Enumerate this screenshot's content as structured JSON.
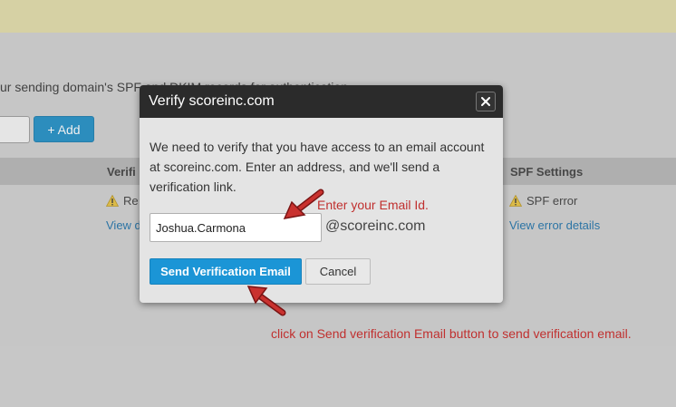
{
  "background": {
    "description": "ur sending domain's SPF and DKIM records for authentication",
    "add_button": "+ Add",
    "columns": {
      "verification": "Verifi",
      "spf": "SPF Settings"
    },
    "row": {
      "status_left": "Re",
      "link_left": "View d",
      "spf_status": "SPF error",
      "spf_link": "View error details"
    },
    "colors": {
      "banner": "#d6d1a4",
      "header_row": "#b4b4b4",
      "link": "#1a6fa8",
      "warning": "#e8c13a"
    }
  },
  "modal": {
    "title": "Verify scoreinc.com",
    "close_icon": "close-icon",
    "message": "We need to verify that you have access to an email account at scoreinc.com. Enter an address, and we'll send a verification link.",
    "email_value": "Joshua.Carmona",
    "domain_suffix": "@scoreinc.com",
    "send_button": "Send Verification Email",
    "cancel_button": "Cancel",
    "colors": {
      "header": "#2b2b2b",
      "primary": "#1b95d6"
    }
  },
  "annotations": {
    "email_hint": "Enter your Email Id.",
    "send_hint": "click on Send verification Email button to send verification email.",
    "color": "#c0302f"
  }
}
